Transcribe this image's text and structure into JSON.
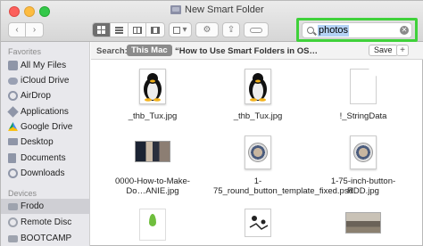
{
  "window": {
    "title": "New Smart Folder"
  },
  "toolbar": {
    "back_glyph": "‹",
    "forward_glyph": "›",
    "view_buttons": [
      "icon-view",
      "list-view",
      "column-view",
      "cover-flow-view"
    ],
    "arrange_glyph": "▾",
    "action_glyph": "⚙",
    "share_glyph": "⇪"
  },
  "search": {
    "value": "photos",
    "clear_glyph": "✕"
  },
  "scope": {
    "label": "Search:",
    "this_mac": "This Mac",
    "query": "“How to Use Smart Folders in OS…",
    "save_label": "Save",
    "plus_label": "+"
  },
  "sidebar": {
    "favorites_header": "Favorites",
    "favorites": [
      {
        "label": "All My Files",
        "icon": "all-files-icon"
      },
      {
        "label": "iCloud Drive",
        "icon": "icloud-icon"
      },
      {
        "label": "AirDrop",
        "icon": "airdrop-icon"
      },
      {
        "label": "Applications",
        "icon": "applications-icon"
      },
      {
        "label": "Google Drive",
        "icon": "google-drive-icon"
      },
      {
        "label": "Desktop",
        "icon": "desktop-icon"
      },
      {
        "label": "Documents",
        "icon": "documents-icon"
      },
      {
        "label": "Downloads",
        "icon": "downloads-icon"
      }
    ],
    "devices_header": "Devices",
    "devices": [
      {
        "label": "Frodo",
        "icon": "drive-icon",
        "selected": true
      },
      {
        "label": "Remote Disc",
        "icon": "disc-icon"
      },
      {
        "label": "BOOTCAMP",
        "icon": "drive-icon"
      }
    ]
  },
  "files": [
    {
      "name": "_thb_Tux.jpg",
      "kind": "tux"
    },
    {
      "name": "_thb_Tux.jpg",
      "kind": "tux"
    },
    {
      "name": "!_StringData",
      "kind": "document"
    },
    {
      "name": "0000-How-to-Make-Do…ANIE.jpg",
      "kind": "photo"
    },
    {
      "name": "1-75_round_button_template_fixed.psd",
      "kind": "button"
    },
    {
      "name": "1-75-inch-button-RDD.jpg",
      "kind": "button"
    },
    {
      "name": "",
      "kind": "leaf"
    },
    {
      "name": "",
      "kind": "sketch"
    },
    {
      "name": "",
      "kind": "house"
    }
  ],
  "colors": {
    "search_highlight": "#3fd13a",
    "selection": "#b4d2f5"
  }
}
